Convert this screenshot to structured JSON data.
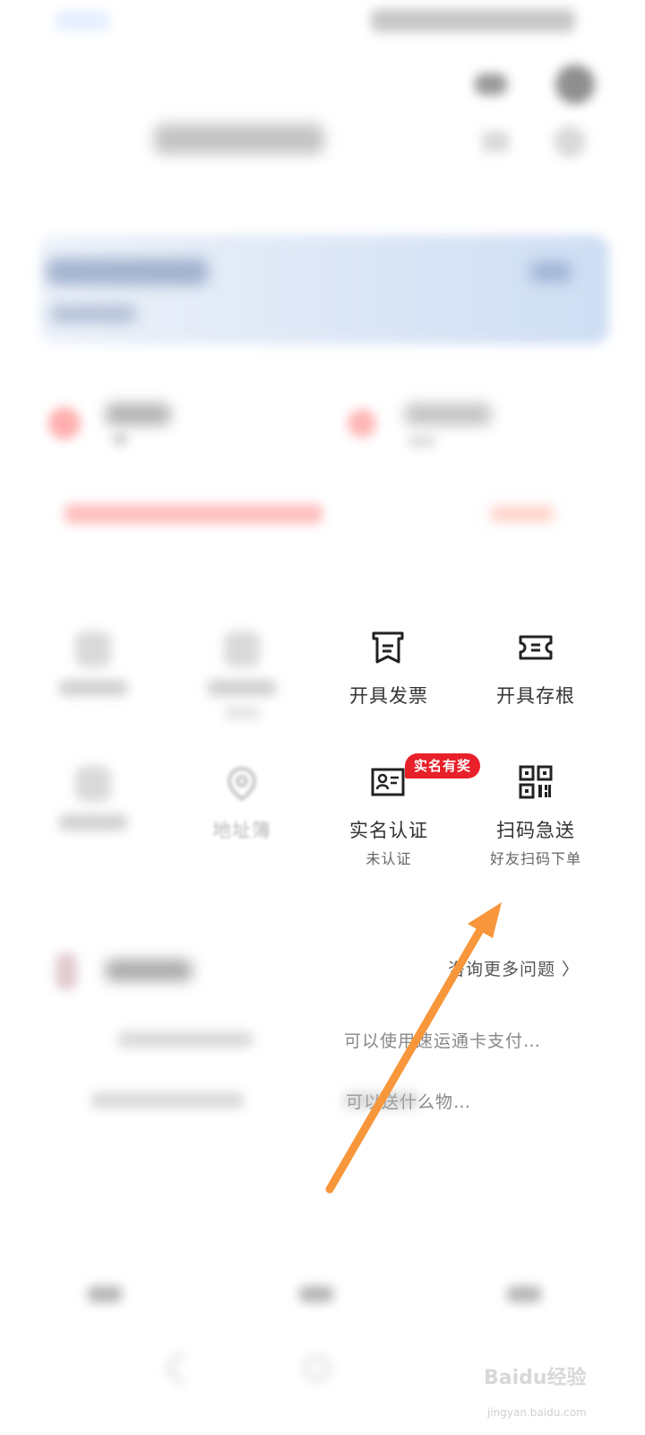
{
  "services_row1": [
    {
      "label": "开具发票",
      "icon": "invoice-icon"
    },
    {
      "label": "开具存根",
      "icon": "ticket-stub-icon"
    }
  ],
  "services_row2": [
    {
      "label": "实名认证",
      "sub": "未认证",
      "icon": "id-card-icon",
      "badge": "实名有奖"
    },
    {
      "label": "扫码急送",
      "sub": "好友扫码下单",
      "icon": "qr-code-icon"
    }
  ],
  "blurred_services": {
    "address_book_label": "地址簿"
  },
  "help": {
    "more_link": "咨询更多问题 〉",
    "questions": [
      "可以使用速运通卡支付…",
      "可以送什么物…"
    ]
  },
  "watermark": {
    "brand": "Baidu经验",
    "domain": "jingyan.baidu.com"
  },
  "colors": {
    "badge_red": "#e8202a",
    "arrow_orange": "#f7963a",
    "banner_blue": "#a7c3ea"
  }
}
